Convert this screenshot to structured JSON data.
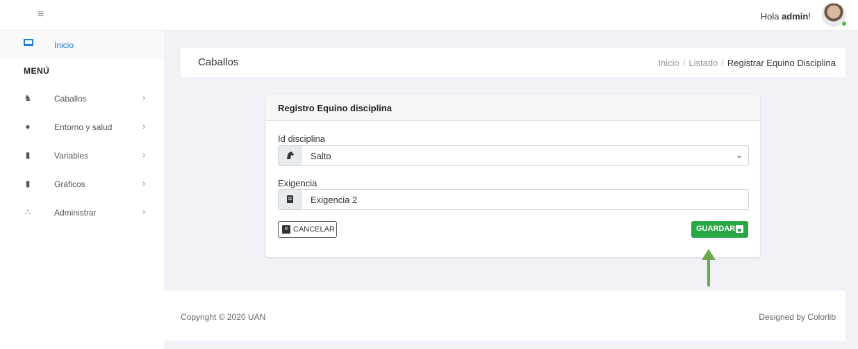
{
  "topbar": {
    "greeting_prefix": "Hola ",
    "user_name": "admin",
    "greeting_suffix": "!"
  },
  "sidebar": {
    "home_label": "Inicio",
    "menu_title": "MENÚ",
    "items": [
      {
        "label": "Caballos",
        "icon": "horse-icon"
      },
      {
        "label": "Entorno y salud",
        "icon": "users-icon"
      },
      {
        "label": "Variables",
        "icon": "file-icon"
      },
      {
        "label": "Gráficos",
        "icon": "file-icon"
      },
      {
        "label": "Administrar",
        "icon": "group-icon"
      }
    ]
  },
  "header": {
    "title": "Caballos",
    "breadcrumb": [
      "Inicio",
      "Listado",
      "Registrar Equino Disciplina"
    ]
  },
  "form": {
    "title": "Registro Equino disciplina",
    "discipline_label": "Id disciplina",
    "discipline_value": "Salto",
    "requirement_label": "Exigencia",
    "requirement_value": "Exigencia 2",
    "cancel_label": "CANCELAR",
    "save_label": "GUARDAR"
  },
  "footer": {
    "copyright": "Copyright © 2020 UAN",
    "designed_by": "Designed by Colorlib"
  },
  "colors": {
    "accent": "#1c7ed6",
    "save_button": "#28a745",
    "annotation_arrow": "#6aa84f"
  }
}
